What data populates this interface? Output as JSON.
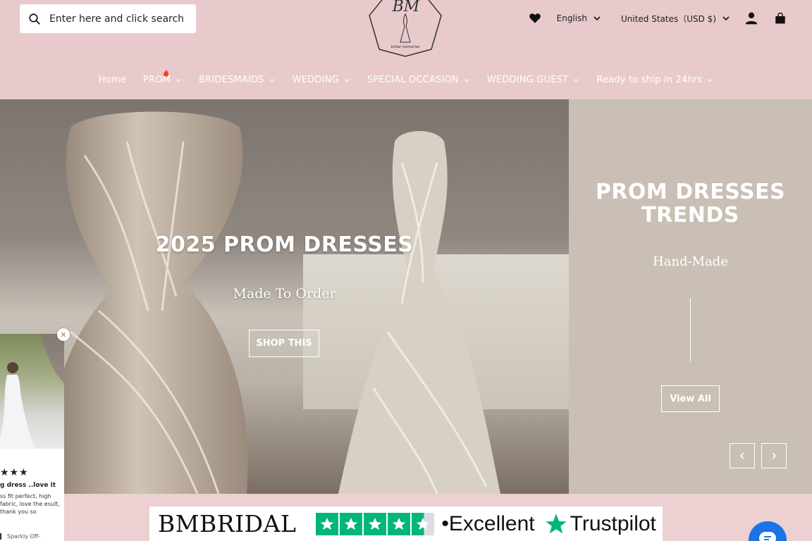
{
  "search": {
    "placeholder": "Enter here and click search"
  },
  "logo": {
    "monogram": "BM",
    "tagline": "bridal memories"
  },
  "header": {
    "language": "English",
    "currency": "United States（USD $)"
  },
  "nav": [
    {
      "label": "Home"
    },
    {
      "label": "PROM"
    },
    {
      "label": "BRIDESMAIDS"
    },
    {
      "label": "WEDDING"
    },
    {
      "label": "SPECIAL OCCASION"
    },
    {
      "label": "WEDDING GUEST"
    },
    {
      "label": "Ready to ship in 24hrs"
    }
  ],
  "hero": {
    "title": "2025 PROM DRESSES",
    "subtitle": "Made To Order",
    "button": "SHOP THIS"
  },
  "side": {
    "title_line1": "PROM DRESSES",
    "title_line2": "TRENDS",
    "subtitle": "Hand-Made",
    "button": "View All"
  },
  "review": {
    "stars": "★★★",
    "title": "g dress ..love it",
    "text": "ss fit perfect, high fabric, love the esult, thank you so",
    "product": "Sparkly Off-"
  },
  "trust": {
    "brand": "BMBRIDAL",
    "rating_word": "Excellent",
    "provider": "Trustpilot",
    "separator": "•"
  },
  "colors": {
    "header_bg": "#e8cacc",
    "panel_bg": "#c9bfb4",
    "trustpilot_green": "#00b67a",
    "chat_blue": "#1a73e8"
  }
}
